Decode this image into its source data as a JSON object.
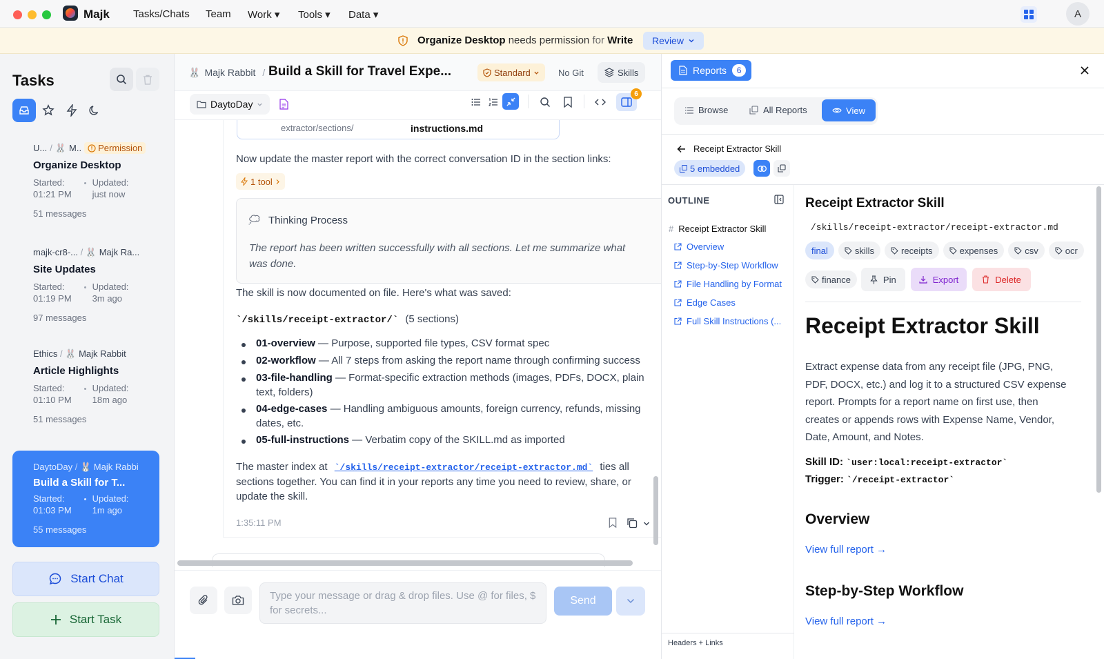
{
  "app": {
    "name": "Majk",
    "avatar_letter": "A"
  },
  "menu": [
    "Tasks/Chats",
    "Team",
    "Work ▾",
    "Tools ▾",
    "Data ▾"
  ],
  "banner": {
    "app": "Organize Desktop",
    "needs": "needs permission",
    "for": "for",
    "perm": "Write",
    "review": "Review"
  },
  "sidebar": {
    "title": "Tasks",
    "tasks": [
      {
        "project": "U...",
        "agent": "M..",
        "badge": "Permission",
        "title": "Organize Desktop",
        "started_label": "Started:",
        "started": "01:21 PM",
        "updated_label": "Updated:",
        "updated": "just now",
        "messages": "51 messages"
      },
      {
        "project": "majk-cr8-...",
        "agent": "Majk Ra...",
        "title": "Site Updates",
        "started_label": "Started:",
        "started": "01:19 PM",
        "updated_label": "Updated:",
        "updated": "3m ago",
        "messages": "97 messages"
      },
      {
        "project": "Ethics",
        "agent": "Majk Rabbit",
        "title": "Article Highlights",
        "started_label": "Started:",
        "started": "01:10 PM",
        "updated_label": "Updated:",
        "updated": "18m ago",
        "messages": "51 messages"
      },
      {
        "project": "DaytoDay",
        "agent": "Majk Rabbit",
        "title": "Build a Skill for T...",
        "started_label": "Started:",
        "started": "01:03 PM",
        "updated_label": "Updated:",
        "updated": "1m ago",
        "messages": "55 messages"
      }
    ],
    "start_chat": "Start Chat",
    "start_task": "Start Task"
  },
  "chat": {
    "agent": "Majk Rabbit",
    "title": "Build a Skill for Travel Expe...",
    "mode": "Standard",
    "git": "No Git",
    "skills": "Skills",
    "panel_badge": "6",
    "project": "DaytoDay",
    "file_path": "extractor/sections/",
    "file_name": "instructions.md",
    "msg1": "Now update the master report with the correct conversation ID in the section links:",
    "tool_chip": "1 tool",
    "thinking_title": "Thinking Process",
    "thinking_text": "The report has been written successfully with all sections. Let me summarize what was done.",
    "saved_text": "The skill is now documented on file. Here's what was saved:",
    "path": "`/skills/receipt-extractor/`",
    "path_note": "(5 sections)",
    "bullets": [
      {
        "k": "01-overview",
        "v": " — Purpose, supported file types, CSV format spec"
      },
      {
        "k": "02-workflow",
        "v": " — All 7 steps from asking the report name through confirming success"
      },
      {
        "k": "03-file-handling",
        "v": " — Format-specific extraction methods (images, PDFs, DOCX, plain",
        "v2": "text, folders)"
      },
      {
        "k": "04-edge-cases",
        "v": " — Handling ambiguous amounts, foreign currency, refunds, missing",
        "v2": "dates, etc."
      },
      {
        "k": "05-full-instructions",
        "v": " — Verbatim copy of the SKILL.md as imported"
      }
    ],
    "master_1": "The master index at",
    "master_link": "`/skills/receipt-extractor/receipt-extractor.md`",
    "master_2": "ties all",
    "master_3": "sections together. You can find it in your reports any time you need to review, share, or",
    "master_4": "update the skill.",
    "timestamp": "1:35:11 PM",
    "input_placeholder": "Type your message or drag & drop files. Use @ for files, $ for secrets...",
    "send": "Send"
  },
  "reports": {
    "label": "Reports",
    "count": "6",
    "tabs": [
      "Browse",
      "All Reports",
      "View"
    ],
    "back_title": "Receipt Extractor Skill",
    "embedded": "5 embedded",
    "outline_title": "OUTLINE",
    "outline": [
      "Receipt Extractor Skill",
      "Overview",
      "Step-by-Step Workflow",
      "File Handling by Format",
      "Edge Cases",
      "Full Skill Instructions (..."
    ],
    "footer": "Headers + Links",
    "doc": {
      "title": "Receipt Extractor Skill",
      "path": "/skills/receipt-extractor/receipt-extractor.md",
      "tags": [
        "final",
        "skills",
        "receipts",
        "expenses",
        "csv",
        "ocr",
        "finance"
      ],
      "pin": "Pin",
      "export": "Export",
      "delete": "Delete",
      "h1": "Receipt Extractor Skill",
      "para": [
        "Extract expense data from any receipt file (JPG, PNG,",
        "PDF, DOCX, etc.) and log it to a structured CSV expense",
        "report. Prompts for a report name on first use, then",
        "creates or appends rows with Expense Name, Vendor,",
        "Date, Amount, and Notes."
      ],
      "skill_id_label": "Skill ID:",
      "skill_id": "`user:local:receipt-extractor`",
      "trigger_label": "Trigger:",
      "trigger": "`/receipt-extractor`",
      "h2a": "Overview",
      "link_a": "View full report →",
      "h2b": "Step-by-Step Workflow",
      "link_b": "View full report →"
    }
  }
}
